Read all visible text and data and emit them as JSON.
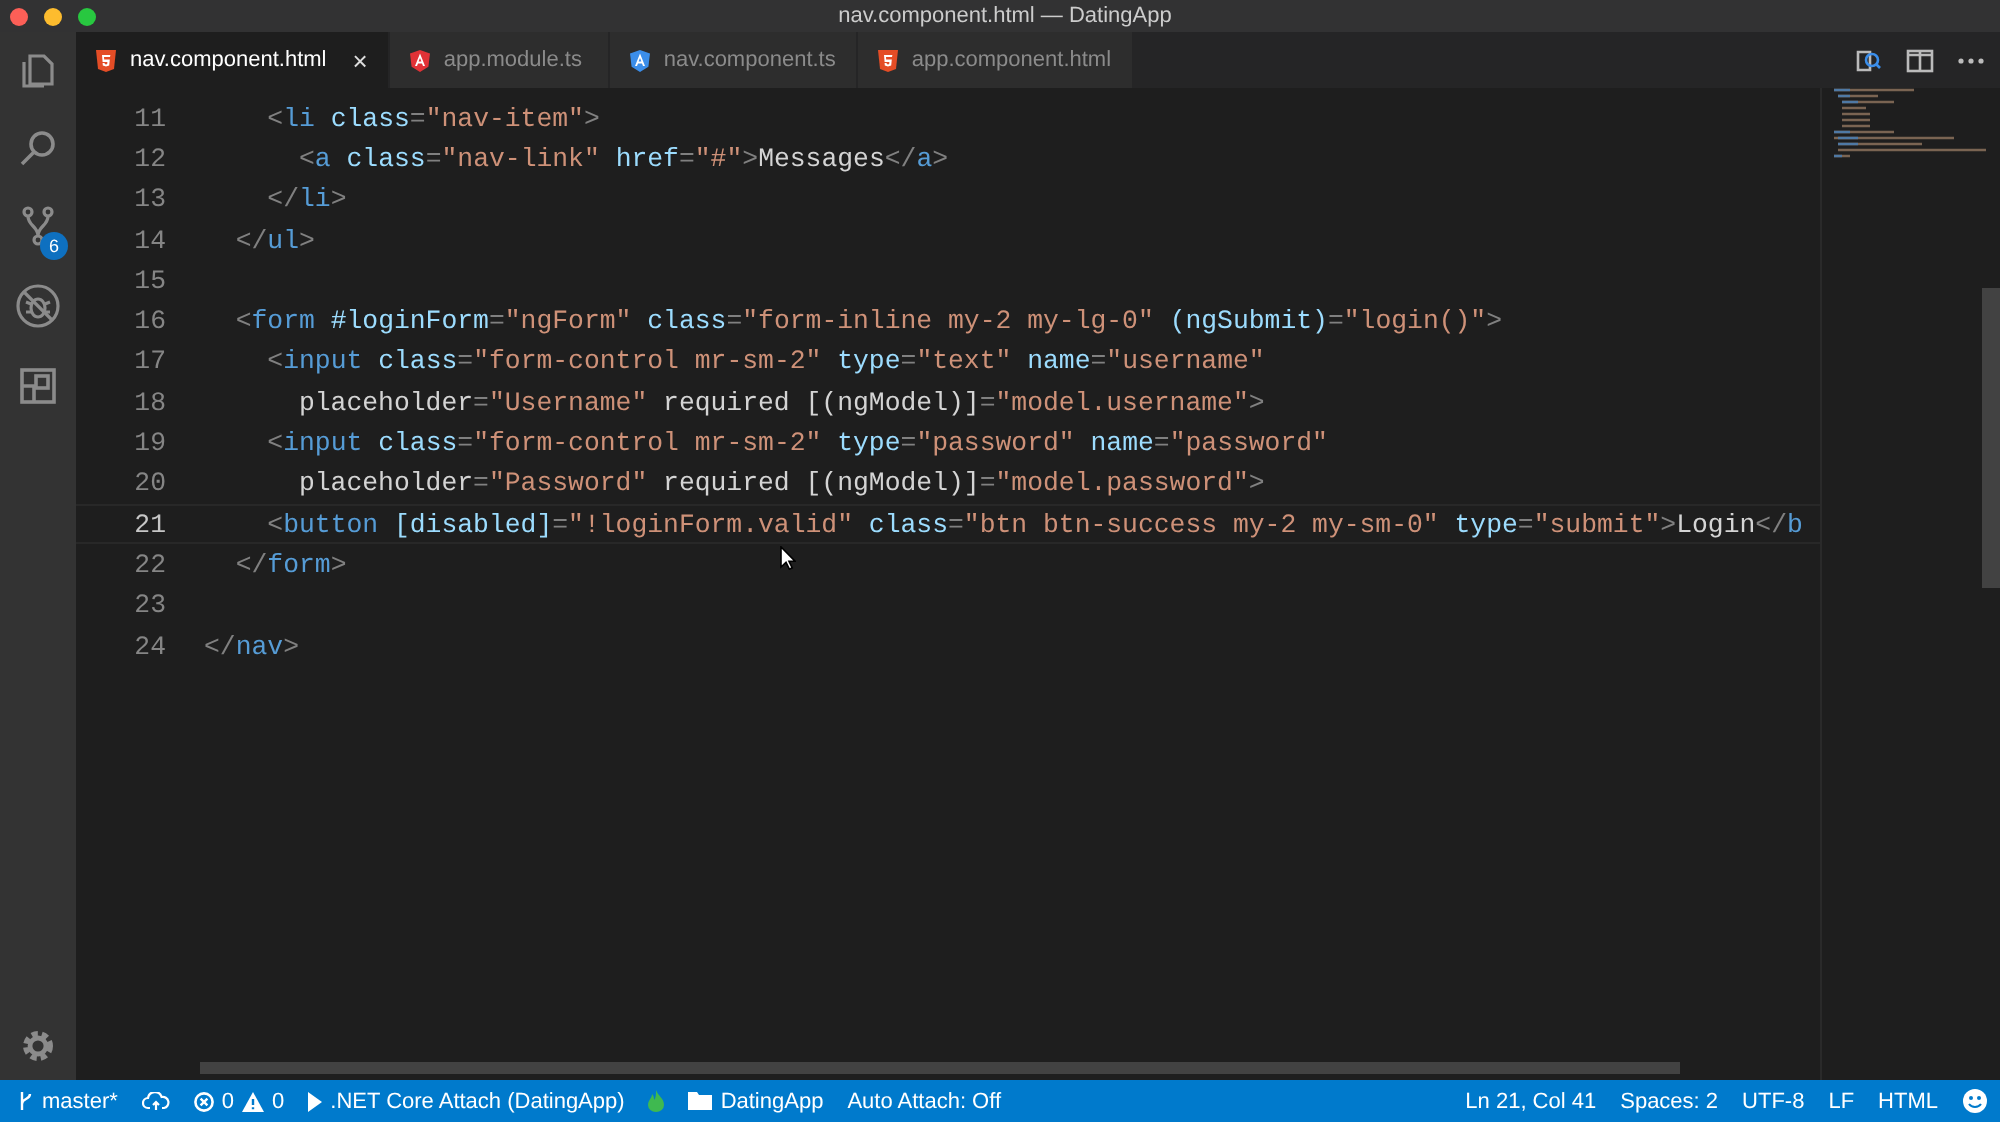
{
  "window": {
    "title": "nav.component.html — DatingApp"
  },
  "activity_bar": {
    "items": [
      {
        "kind": "explorer"
      },
      {
        "kind": "search"
      },
      {
        "kind": "source-control",
        "badge": "6"
      },
      {
        "kind": "debug"
      },
      {
        "kind": "extensions"
      }
    ],
    "bottom": [
      {
        "kind": "settings"
      }
    ]
  },
  "tabs": [
    {
      "label": "nav.component.html",
      "kind": "html",
      "selected": true,
      "close": "×"
    },
    {
      "label": "app.module.ts",
      "kind": "angular",
      "color": "#e23237",
      "selected": false
    },
    {
      "label": "nav.component.ts",
      "kind": "angular",
      "color": "#3b8eea",
      "selected": false
    },
    {
      "label": "app.component.html",
      "kind": "html",
      "selected": false
    }
  ],
  "editor": {
    "lines": [
      {
        "number": "11",
        "current": false,
        "code": "    <li class=\"nav-item\">"
      },
      {
        "number": "12",
        "current": false,
        "code": "      <a class=\"nav-link\" href=\"#\">Messages</a>"
      },
      {
        "number": "13",
        "current": false,
        "code": "    </li>"
      },
      {
        "number": "14",
        "current": false,
        "code": "  </ul>"
      },
      {
        "number": "15",
        "current": false
      },
      {
        "number": "16",
        "current": false,
        "code": "  <form #loginForm=\"ngForm\" class=\"form-inline my-2 my-lg-0\" (ngSubmit)=\"login()\">"
      },
      {
        "number": "17",
        "current": false,
        "code": "    <input class=\"form-control mr-sm-2\" type=\"text\" name=\"username\""
      },
      {
        "number": "18",
        "current": false,
        "code": "      placeholder=\"Username\" required [(ngModel)]=\"model.username\">"
      },
      {
        "number": "19",
        "current": false,
        "code": "    <input class=\"form-control mr-sm-2\" type=\"password\" name=\"password\""
      },
      {
        "number": "20",
        "current": false,
        "code": "      placeholder=\"Password\" required [(ngModel)]=\"model.password\">"
      },
      {
        "number": "21",
        "current": true,
        "code": "    <button [disabled]=\"!loginForm.valid\" class=\"btn btn-success my-2 my-sm-0\" type=\"submit\">Login</b"
      },
      {
        "number": "22",
        "current": false,
        "code": "  </form>"
      },
      {
        "number": "23",
        "current": false
      },
      {
        "number": "24",
        "current": false,
        "code": "</nav>"
      }
    ]
  },
  "status_bar": {
    "left": [
      {
        "kind": "branch",
        "text": "master*"
      },
      {
        "kind": "sync"
      },
      {
        "kind": "problems",
        "errors": "0",
        "warnings": "0"
      },
      {
        "kind": "debug",
        "text": ".NET Core Attach (DatingApp)"
      },
      {
        "kind": "flame"
      },
      {
        "kind": "folder",
        "text": "DatingApp"
      },
      {
        "kind": "plain",
        "text": "Auto Attach: Off"
      }
    ],
    "right": [
      {
        "kind": "plain",
        "text": "Ln 21, Col 41"
      },
      {
        "kind": "plain",
        "text": "Spaces: 2"
      },
      {
        "kind": "plain",
        "text": "UTF-8"
      },
      {
        "kind": "plain",
        "text": "LF"
      },
      {
        "kind": "plain",
        "text": "HTML"
      },
      {
        "kind": "feedback"
      }
    ]
  }
}
